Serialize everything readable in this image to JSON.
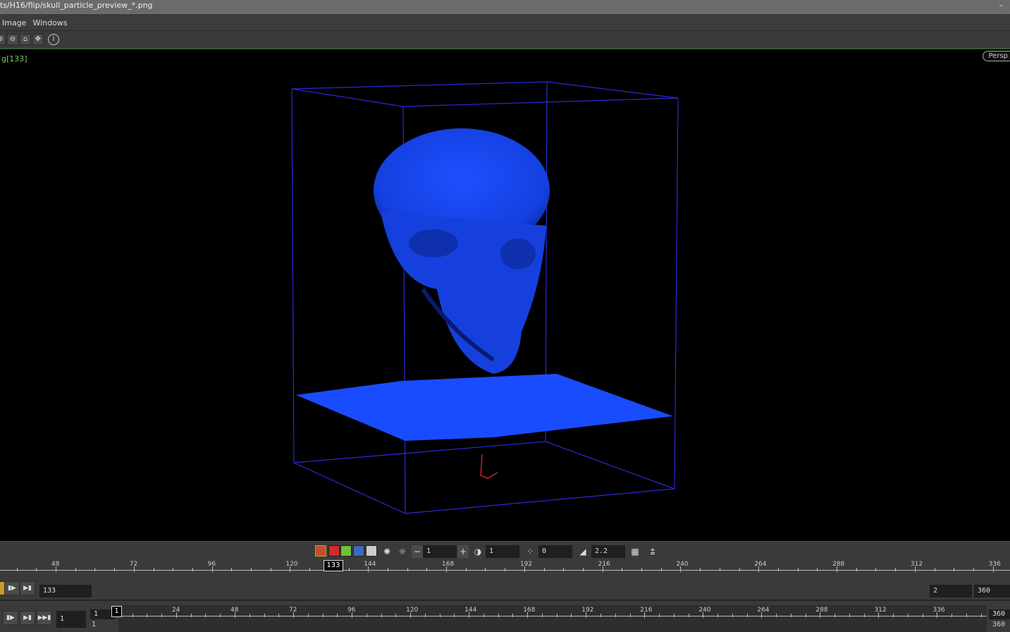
{
  "window": {
    "title": "ts/H16/flip/skull_particle_preview_*.png",
    "close": "–"
  },
  "menu": [
    "Image",
    "Windows"
  ],
  "toolbar": {
    "info_icon": "info-icon"
  },
  "viewport": {
    "label": "g[133]",
    "camera": "Persp",
    "bbox_color": "#2a2ad8",
    "particle_color": "#1a4cff",
    "axis_color": "#cc2222"
  },
  "controls": {
    "channels": [
      "rgb",
      "red",
      "green",
      "blue",
      "alpha"
    ],
    "channel_colors": [
      "#c0502a",
      "#d42a2a",
      "#6fc23a",
      "#3a6ac0",
      "#cccccc"
    ],
    "minus": "−",
    "plus": "+",
    "layer": "1",
    "brightness": "1",
    "offset": "0",
    "gamma": "2.2"
  },
  "timeline1": {
    "ticks": [
      "48",
      "72",
      "96",
      "120",
      "144",
      "168",
      "192",
      "216",
      "240",
      "264",
      "288",
      "312",
      "336"
    ],
    "current": "133"
  },
  "playbar1": {
    "frame": "133",
    "start": "2",
    "end": "360"
  },
  "playbar2": {
    "frame": "1",
    "range_start_a": "1",
    "range_start_b": "1",
    "end_a": "360",
    "end_b": "360"
  },
  "timeline2": {
    "current": "1",
    "ticks": [
      "24",
      "48",
      "72",
      "96",
      "120",
      "144",
      "168",
      "192",
      "216",
      "240",
      "264",
      "288",
      "312",
      "336"
    ]
  }
}
